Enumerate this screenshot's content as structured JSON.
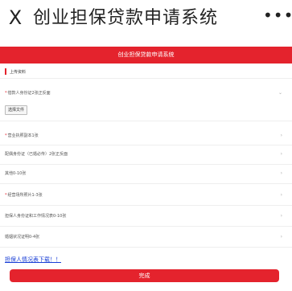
{
  "nav": {
    "close_glyph": "X",
    "title": "创业担保贷款申请系统",
    "more_glyph": "•••"
  },
  "header": {
    "title": "创业担保贷款申请系统"
  },
  "section": {
    "label": "上传资料"
  },
  "upload": {
    "select_placeholder": "借款人身份证2张正反面",
    "choose_file_label": "选择文件"
  },
  "items": [
    {
      "label": "营业执照副本1张",
      "required": true
    },
    {
      "label": "配偶身份证（已婚必传）2张正反面",
      "required": false
    },
    {
      "label": "其他0-10张",
      "required": false
    },
    {
      "label": "经营场所照片1-3张",
      "required": true
    },
    {
      "label": "担保人身份证和工作情况表0-10张",
      "required": false
    },
    {
      "label": "婚姻状况证明0-4张",
      "required": false
    }
  ],
  "download_link": "担保人情况表下载！！",
  "finish_label": "完成",
  "colors": {
    "accent": "#e4232d",
    "link": "#1a3fd6"
  },
  "icons": {
    "close": "close-icon",
    "more": "more-icon",
    "chevron": "chevron-right-icon"
  }
}
